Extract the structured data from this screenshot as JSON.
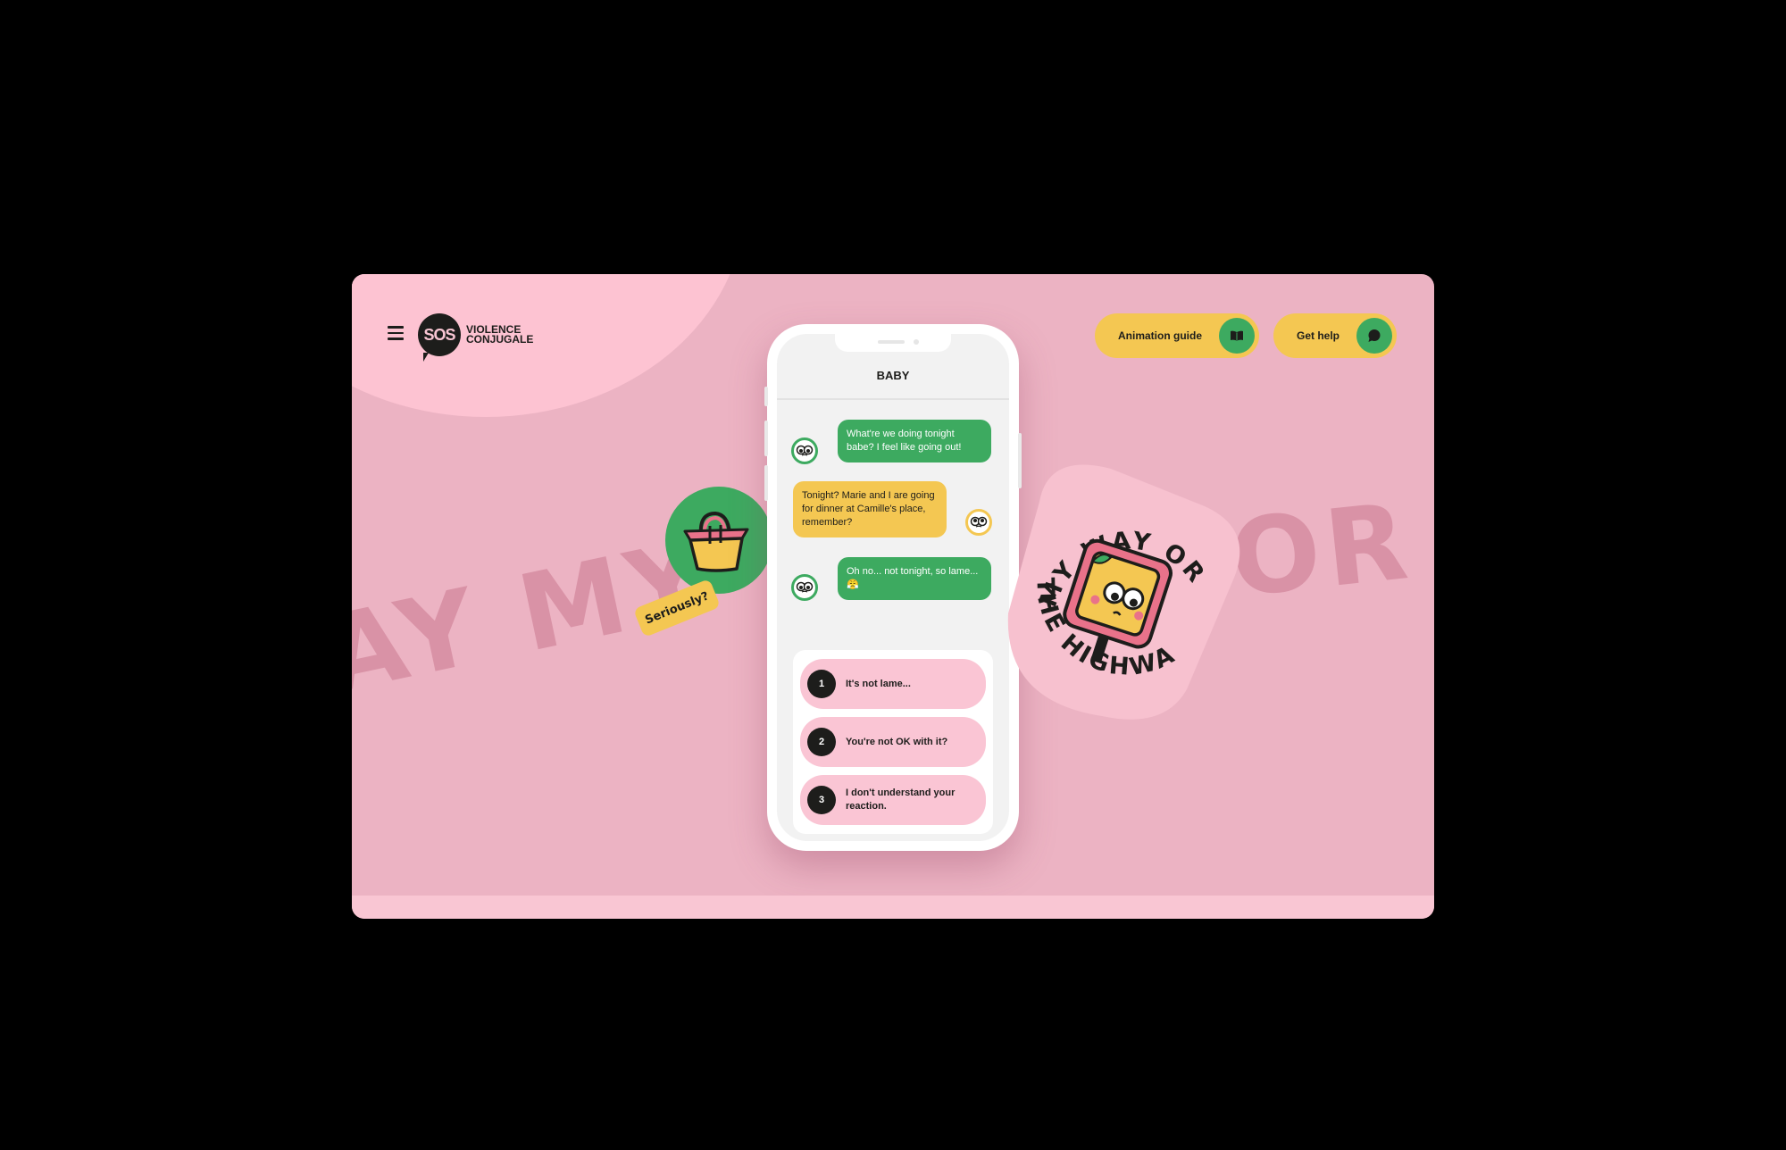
{
  "brand": {
    "logo_badge": "SOS",
    "line1": "VIOLENCE",
    "line2": "CONJUGALE"
  },
  "nav": {
    "guide_label": "Animation guide",
    "help_label": "Get help"
  },
  "background_words": {
    "left": "AY MY",
    "right": "OR"
  },
  "chat": {
    "contact": "BABY",
    "messages": [
      {
        "from": "partner",
        "text": "What're we doing tonight babe? I feel like going out!"
      },
      {
        "from": "me",
        "text": "Tonight? Marie and I are going for dinner at Camille's place, remember?"
      },
      {
        "from": "partner",
        "text": "Oh no... not tonight, so lame... 😤"
      }
    ],
    "answers": [
      {
        "num": "1",
        "text": "It's not lame..."
      },
      {
        "num": "2",
        "text": "You're not OK with it?"
      },
      {
        "num": "3",
        "text": "I don't understand your reaction."
      }
    ]
  },
  "stickers": {
    "seriously": "Seriously?",
    "highway_top": "MY WAY OR",
    "highway_bottom": "THE HIGHWAY"
  },
  "colors": {
    "background": "#ECB3C3",
    "green": "#3DAA60",
    "yellow": "#F4C752",
    "pink": "#FAC5D4",
    "dark": "#1d1d1b"
  },
  "icons": {
    "menu": "hamburger-icon",
    "guide": "book-icon",
    "help": "speech-bubble-icon"
  }
}
